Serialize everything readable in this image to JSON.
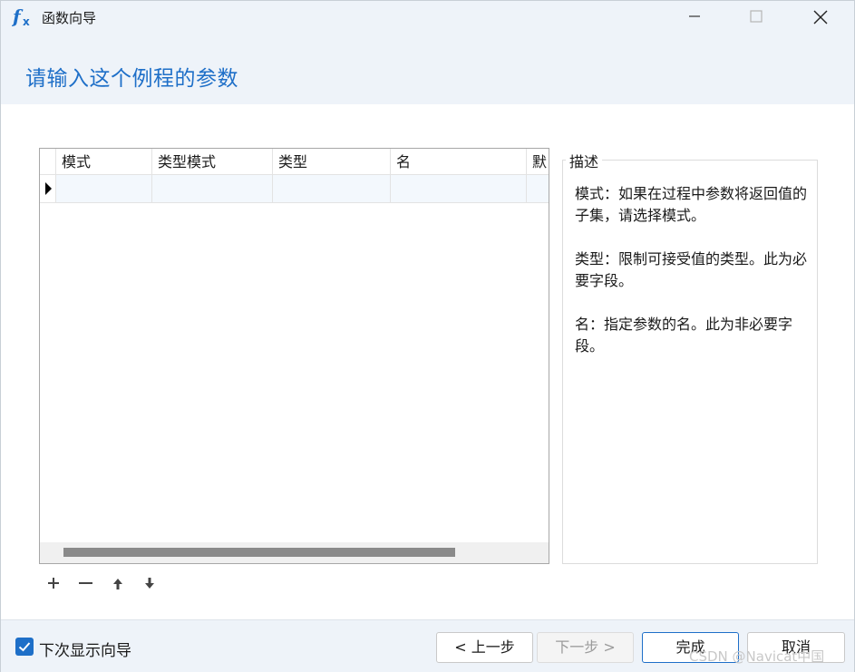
{
  "window": {
    "title": "函数向导",
    "app_icon": "fx-icon"
  },
  "header": {
    "title": "请输入这个例程的参数"
  },
  "grid": {
    "columns": [
      "模式",
      "类型模式",
      "类型",
      "名",
      "默"
    ],
    "rows": [
      [
        "",
        "",
        "",
        "",
        ""
      ]
    ]
  },
  "description": {
    "legend": "描述",
    "paragraphs": [
      "模式：如果在过程中参数将返回值的子集，请选择模式。",
      "类型：限制可接受值的类型。此为必要字段。",
      "名：指定参数的名。此为非必要字段。"
    ]
  },
  "toolbar": {
    "icons": [
      "plus-icon",
      "minus-icon",
      "arrow-up-icon",
      "arrow-down-icon"
    ]
  },
  "footer": {
    "show_next_time": {
      "label": "下次显示向导",
      "checked": true
    },
    "buttons": {
      "back": "< 上一步",
      "next": "下一步 >",
      "finish": "完成",
      "cancel": "取消"
    }
  },
  "watermark": "CSDN @Navicat中国",
  "colors": {
    "accent": "#1e6fc8",
    "chrome_bg": "#eef3f9",
    "row_highlight": "#f3f8fd"
  }
}
